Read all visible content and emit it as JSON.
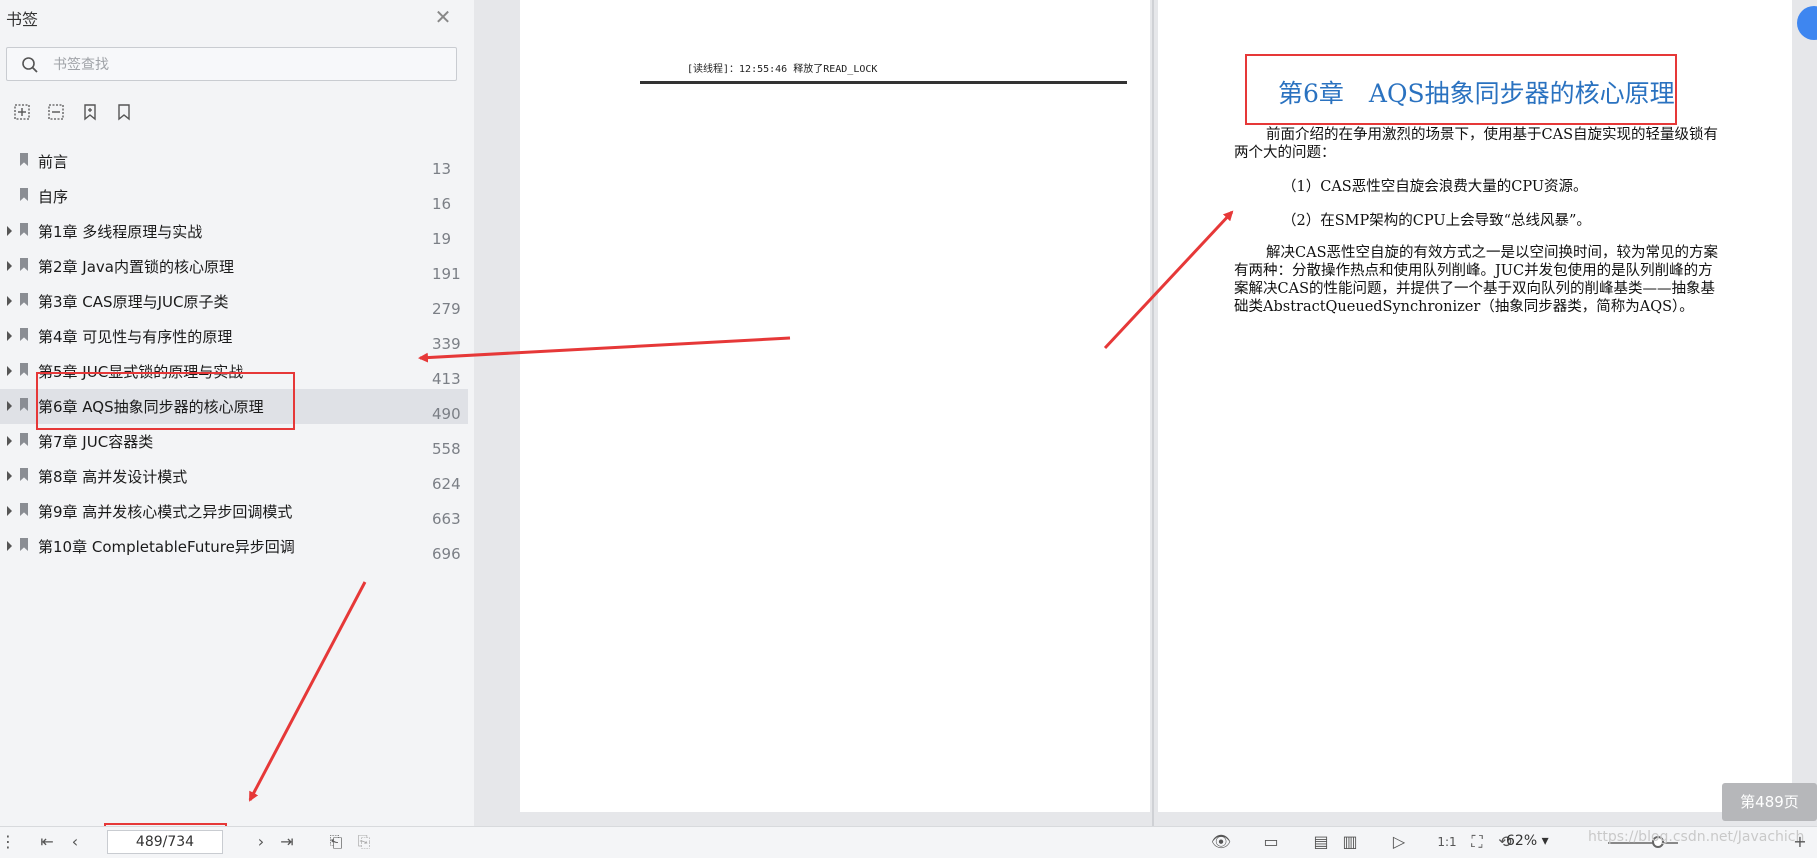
{
  "sidebar": {
    "title": "书签",
    "search_placeholder": "书签查找",
    "items": [
      {
        "label": "前言",
        "page": "13",
        "has_children": false
      },
      {
        "label": "自序",
        "page": "16",
        "has_children": false
      },
      {
        "label": "第1章 多线程原理与实战",
        "page": "19",
        "has_children": true
      },
      {
        "label": "第2章 Java内置锁的核心原理",
        "page": "191",
        "has_children": true
      },
      {
        "label": "第3章 CAS原理与JUC原子类",
        "page": "279",
        "has_children": true
      },
      {
        "label": "第4章 可见性与有序性的原理",
        "page": "339",
        "has_children": true
      },
      {
        "label": "第5章 JUC显式锁的原理与实战",
        "page": "413",
        "has_children": true
      },
      {
        "label": "第6章 AQS抽象同步器的核心原理",
        "page": "490",
        "has_children": true,
        "selected": true
      },
      {
        "label": "第7章 JUC容器类",
        "page": "558",
        "has_children": true
      },
      {
        "label": "第8章 高并发设计模式",
        "page": "624",
        "has_children": true
      },
      {
        "label": "第9章 高并发核心模式之异步回调模式",
        "page": "663",
        "has_children": true
      },
      {
        "label": "第10章 CompletableFuture异步回调",
        "page": "696",
        "has_children": true
      }
    ]
  },
  "document": {
    "left_page": {
      "log_line": "[读线程]：12:55:46 释放了READ_LOCK"
    },
    "right_page": {
      "chapter_title": "第6章　AQS抽象同步器的核心原理",
      "para1": "前面介绍的在争用激烈的场景下，使用基于CAS自旋实现的轻量级锁有两个大的问题：",
      "para2": "（1）CAS恶性空自旋会浪费大量的CPU资源。",
      "para3": "（2）在SMP架构的CPU上会导致“总线风暴”。",
      "para4": "解决CAS恶性空自旋的有效方式之一是以空间换时间，较为常见的方案有两种：分散操作热点和使用队列削峰。JUC并发包使用的是队列削峰的方案解决CAS的性能问题，并提供了一个基于双向队列的削峰基类——抽象基础类AbstractQueuedSynchronizer（抽象同步器类，简称为AQS）。"
    },
    "page_badge": "第489页"
  },
  "bottombar": {
    "page_value": "489/734",
    "zoom": "62%",
    "watermark": "https://blog.csdn.net/Javachich"
  },
  "colors": {
    "annotation_red": "#e63838",
    "chapter_blue": "#2a72c0",
    "selected_row": "#dfe1e6"
  }
}
